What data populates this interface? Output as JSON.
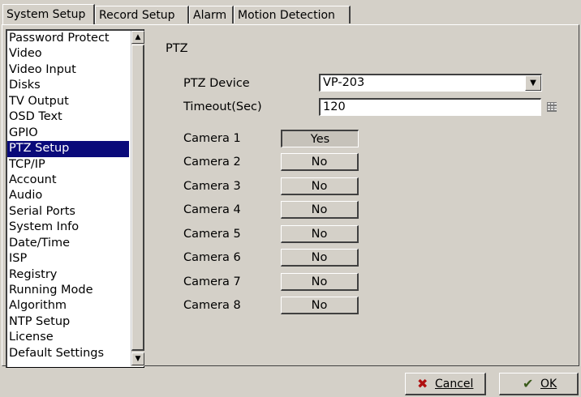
{
  "tabs": [
    {
      "label": "System Setup",
      "active": true
    },
    {
      "label": "Record Setup",
      "active": false
    },
    {
      "label": "Alarm",
      "active": false
    },
    {
      "label": "Motion Detection",
      "active": false
    }
  ],
  "sidebar": {
    "items": [
      "Password Protect",
      "Video",
      "Video Input",
      "Disks",
      "TV Output",
      "OSD Text",
      "GPIO",
      "PTZ Setup",
      "TCP/IP",
      "Account",
      "Audio",
      "Serial Ports",
      "System Info",
      "Date/Time",
      "ISP",
      "Registry",
      "Running Mode",
      "Algorithm",
      "NTP Setup",
      "License",
      "Default Settings"
    ],
    "selected": "PTZ Setup"
  },
  "panel": {
    "title": "PTZ",
    "ptz_device_label": "PTZ Device",
    "ptz_device_value": "VP-203",
    "timeout_label": "Timeout(Sec)",
    "timeout_value": "120",
    "cameras": [
      {
        "label": "Camera 1",
        "value": "Yes"
      },
      {
        "label": "Camera 2",
        "value": "No"
      },
      {
        "label": "Camera 3",
        "value": "No"
      },
      {
        "label": "Camera 4",
        "value": "No"
      },
      {
        "label": "Camera 5",
        "value": "No"
      },
      {
        "label": "Camera 6",
        "value": "No"
      },
      {
        "label": "Camera 7",
        "value": "No"
      },
      {
        "label": "Camera 8",
        "value": "No"
      }
    ]
  },
  "buttons": {
    "cancel_label": "Cancel",
    "ok_label": "OK"
  },
  "icons": {
    "cancel": "x-mark-icon",
    "ok": "checkmark-icon",
    "dropdown": "chevron-down-icon",
    "keypad": "keypad-icon"
  },
  "colors": {
    "selection": "#0a0a7a",
    "background": "#d4d0c8"
  }
}
